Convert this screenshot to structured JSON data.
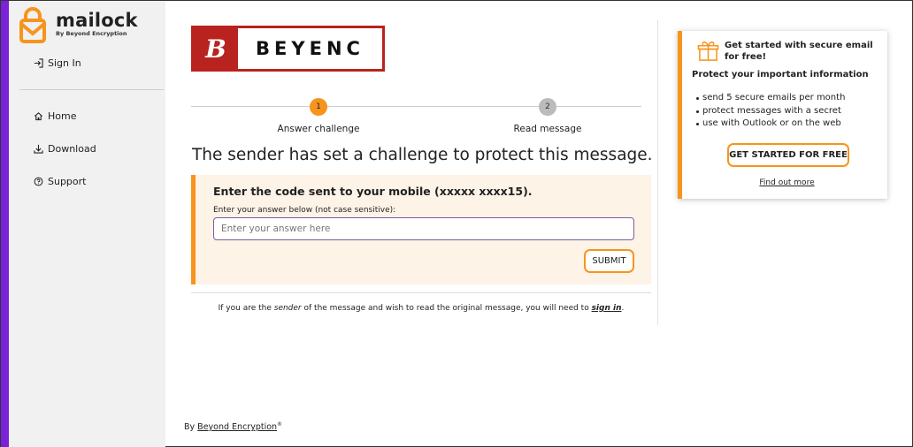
{
  "sidebar": {
    "logo": {
      "name": "mailock",
      "subtitle": "By Beyond Encryption"
    },
    "sign_in": "Sign In",
    "items": [
      {
        "label": "Home",
        "icon": "home-icon"
      },
      {
        "label": "Download",
        "icon": "download-icon"
      },
      {
        "label": "Support",
        "icon": "help-circle-icon"
      }
    ],
    "byline_prefix": "By ",
    "byline_link": "Beyond Encryption",
    "byline_mark": "®"
  },
  "brand": {
    "initial": "B",
    "name": "BEYENC",
    "color": "#b8231f"
  },
  "steps": [
    {
      "number": "1",
      "label": "Answer challenge",
      "active": true
    },
    {
      "number": "2",
      "label": "Read message",
      "active": false
    }
  ],
  "main": {
    "heading": "The sender has set a challenge to protect this message.",
    "challenge_title": "Enter the code sent to your mobile (xxxxx xxxx15).",
    "answer_label": "Enter your answer below (not case sensitive):",
    "answer_placeholder": "Enter your answer here",
    "answer_value": "",
    "submit_label": "SUBMIT",
    "note_part1": "If you are the ",
    "note_sender": "sender",
    "note_part2": " of the message and wish to read the original message, you will need to ",
    "note_link": "sign in",
    "note_end": "."
  },
  "promo": {
    "title": "Get started with secure email for free!",
    "subtitle": "Protect your important information",
    "bullets": [
      "send 5 secure emails per month",
      "protect messages with a secret",
      "use with Outlook or on the web"
    ],
    "cta": "GET STARTED FOR FREE",
    "link": "Find out more"
  },
  "colors": {
    "accent": "#f7941d",
    "purple": "#7a22d8",
    "sidebar_bg": "#f1f1f1",
    "challenge_bg": "#fdf3e6"
  }
}
